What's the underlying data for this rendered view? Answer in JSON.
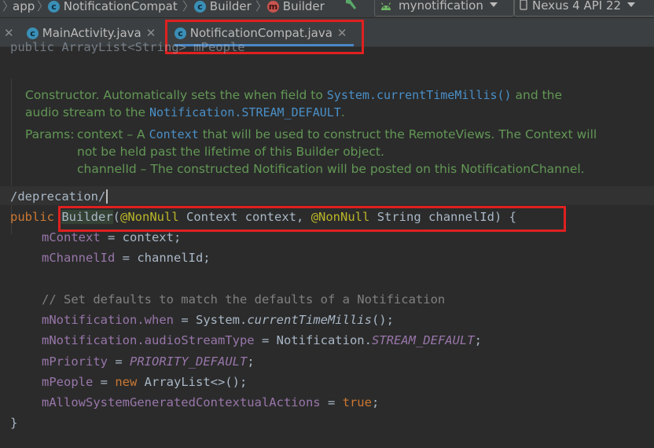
{
  "breadcrumb": {
    "items": [
      {
        "label": "app"
      },
      {
        "label": "NotificationCompat",
        "icon": "class-icon"
      },
      {
        "label": "Builder",
        "icon": "class-icon"
      },
      {
        "label": "Builder",
        "icon": "method-icon"
      }
    ]
  },
  "toolbar": {
    "run_config": "mynotification",
    "device": "Nexus 4 API 22"
  },
  "tabs": [
    {
      "label": "MainActivity.java",
      "active": false
    },
    {
      "label": "NotificationCompat.java",
      "active": true
    }
  ],
  "editor": {
    "top_partial": "public ArrayList<String> mPeople",
    "doc": {
      "line1_pre": "Constructor. Automatically sets the when field to ",
      "line1_code": "System.currentTimeMillis()",
      "line1_post": " and the",
      "line2_pre": "audio stream to the ",
      "line2_code": "Notification.STREAM_DEFAULT",
      "line2_post": ".",
      "params_label": "Params:",
      "param1_pre": "context – A ",
      "param1_code": "Context",
      "param1_post": " that will be used to construct the RemoteViews. The Context will",
      "param1_cont": "not be held past the lifetime of this Builder object.",
      "param2": "channelId – The constructed Notification will be posted on this NotificationChannel."
    },
    "deprecation": "/deprecation/",
    "code": {
      "l1_kw": "public",
      "l1_method": "Builder",
      "l1_anno1": "@NonNull",
      "l1_type1": "Context",
      "l1_p1": "context,",
      "l1_anno2": "@NonNull",
      "l1_type2": "String",
      "l1_p2": "channelId) {",
      "l2_field": "mContext",
      "l2_rest": " = context;",
      "l3_field": "mChannelId",
      "l3_rest": " = channelId;",
      "l5_comment": "// Set defaults to match the defaults of a Notification",
      "l6_field": "mNotification",
      "l6_mid": ".when",
      "l6_eq": " = System.",
      "l6_call": "currentTimeMillis",
      "l6_end": "();",
      "l7_field": "mNotification",
      "l7_mid": ".audioStreamType",
      "l7_eq": " = Notification.",
      "l7_const": "STREAM_DEFAULT",
      "l7_end": ";",
      "l8_field": "mPriority",
      "l8_eq": " = ",
      "l8_const": "PRIORITY_DEFAULT",
      "l8_end": ";",
      "l9_field": "mPeople",
      "l9_eq": " = ",
      "l9_kw": "new",
      "l9_rest": " ArrayList<>();",
      "l10_field": "mAllowSystemGeneratedContextualActions",
      "l10_eq": " = ",
      "l10_kw": "true",
      "l10_end": ";",
      "l11": "}"
    }
  },
  "colors": {
    "keyword": "#cc7832",
    "field": "#9876aa",
    "annotation": "#bbb529",
    "doc_text": "#629755",
    "highlight_box": "#e02020"
  }
}
